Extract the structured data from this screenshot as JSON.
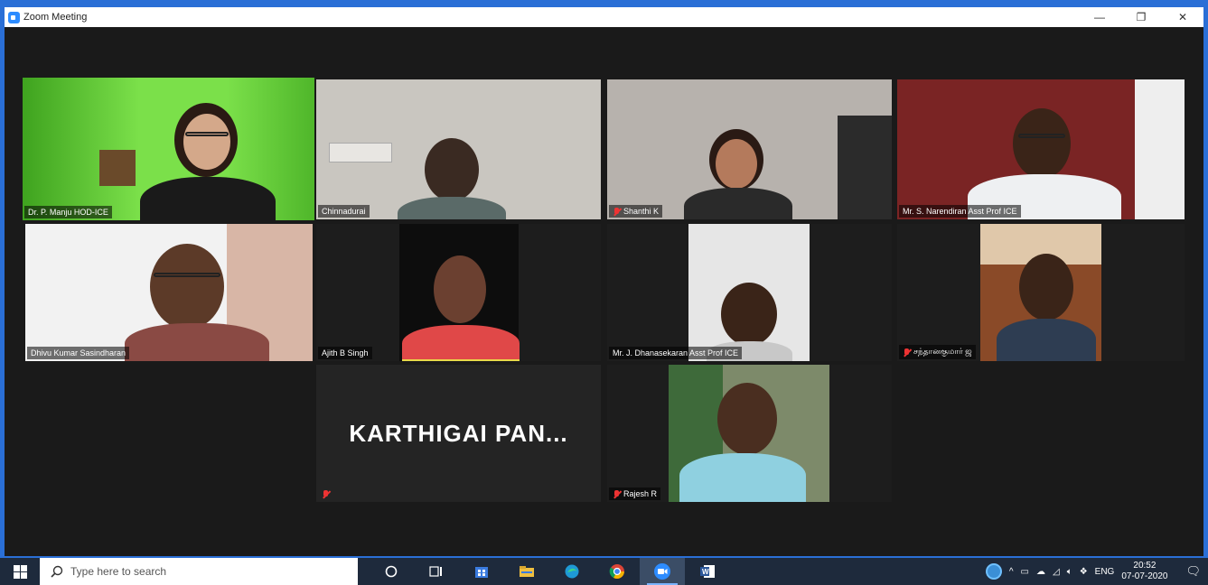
{
  "window": {
    "title": "Zoom Meeting",
    "controls": {
      "minimize": "—",
      "restore": "❐",
      "close": "✕"
    }
  },
  "participants": [
    {
      "name": "Dr. P. Manju HOD-ICE",
      "muted": false,
      "active_speaker": true
    },
    {
      "name": "Chinnadurai",
      "muted": false
    },
    {
      "name": "Shanthi K",
      "muted": true
    },
    {
      "name": "Mr. S. Narendiran Asst Prof ICE",
      "muted": false
    },
    {
      "name": "Dhivu Kumar Sasindharan",
      "muted": false
    },
    {
      "name": "Ajith B Singh",
      "muted": false
    },
    {
      "name": "Mr. J. Dhanasekaran Asst Prof ICE",
      "muted": false
    },
    {
      "name": "சந்தானகுமார் ஜ",
      "muted": true
    },
    {
      "name": "",
      "card_text": "KARTHIGAI  PAN...",
      "muted": true
    },
    {
      "name": "Rajesh R",
      "muted": true
    }
  ],
  "taskbar": {
    "search_placeholder": "Type here to search",
    "icons": [
      "cortana-icon",
      "task-view-icon",
      "store-icon",
      "file-explorer-icon",
      "edge-icon",
      "chrome-icon",
      "zoom-icon",
      "word-icon"
    ],
    "tray": {
      "language": "ENG"
    },
    "clock": {
      "time": "20:52",
      "date": "07-07-2020"
    }
  }
}
